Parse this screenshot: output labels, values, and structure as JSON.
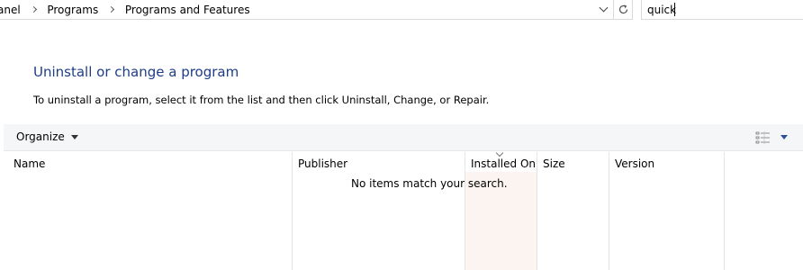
{
  "address_bar": {
    "breadcrumbs": [
      "anel",
      "Programs",
      "Programs and Features"
    ]
  },
  "search": {
    "value": "quick",
    "placeholder": ""
  },
  "header": {
    "title": "Uninstall or change a program",
    "description": "To uninstall a program, select it from the list and then click Uninstall, Change, or Repair."
  },
  "toolbar": {
    "organize_label": "Organize"
  },
  "table": {
    "columns": [
      "Name",
      "Publisher",
      "Installed On",
      "Size",
      "Version"
    ],
    "sorted_column": "Installed On",
    "empty_message": "No items match your search."
  },
  "colors": {
    "title": "#1e3d87",
    "sorted_column_bg": "#fbf4f1",
    "command_bar_bg": "#f5f6f7"
  }
}
